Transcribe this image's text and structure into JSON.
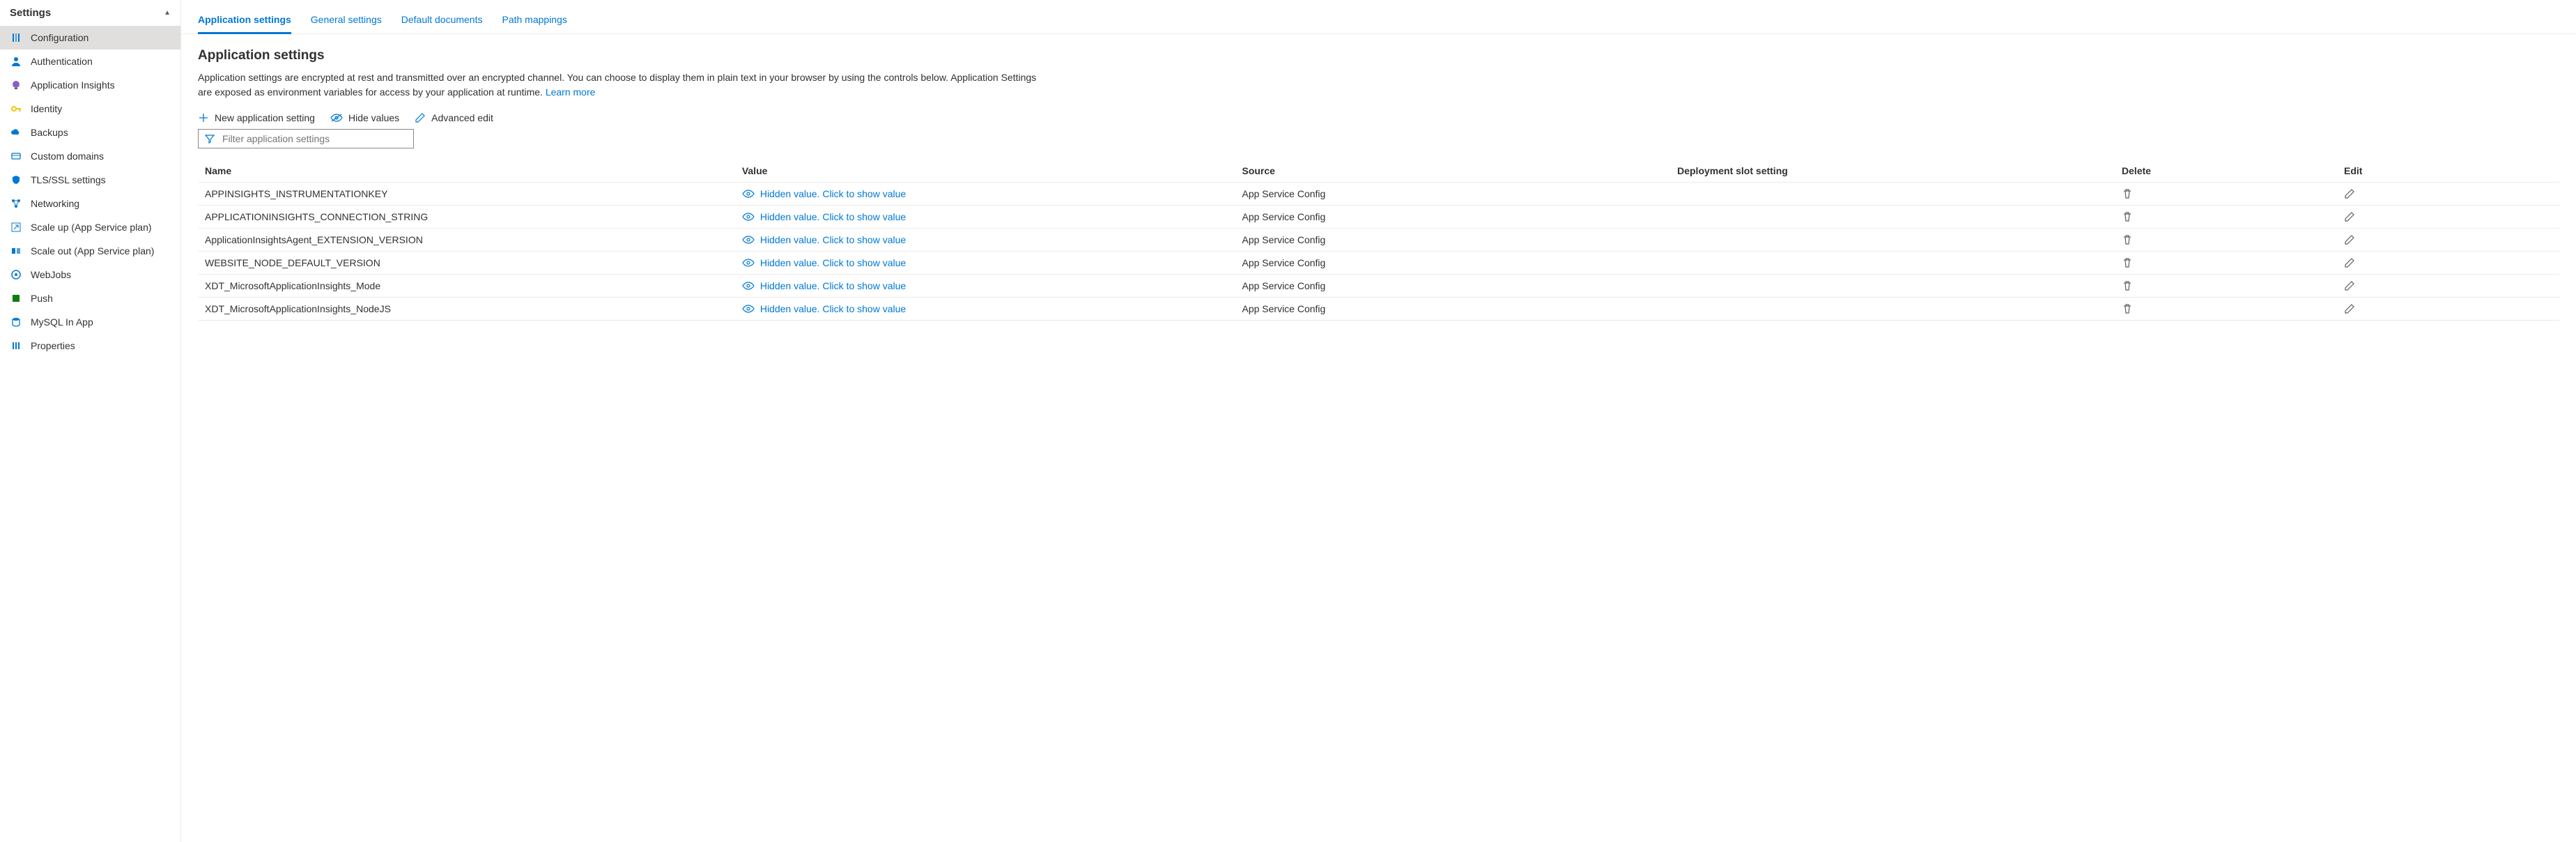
{
  "sidebar": {
    "title": "Settings",
    "items": [
      {
        "label": "Configuration",
        "icon": "sliders",
        "active": true
      },
      {
        "label": "Authentication",
        "icon": "person",
        "active": false
      },
      {
        "label": "Application Insights",
        "icon": "bulb",
        "active": false
      },
      {
        "label": "Identity",
        "icon": "key",
        "active": false
      },
      {
        "label": "Backups",
        "icon": "cloud",
        "active": false
      },
      {
        "label": "Custom domains",
        "icon": "domain",
        "active": false
      },
      {
        "label": "TLS/SSL settings",
        "icon": "shield",
        "active": false
      },
      {
        "label": "Networking",
        "icon": "network",
        "active": false
      },
      {
        "label": "Scale up (App Service plan)",
        "icon": "scaleup",
        "active": false
      },
      {
        "label": "Scale out (App Service plan)",
        "icon": "scaleout",
        "active": false
      },
      {
        "label": "WebJobs",
        "icon": "webjobs",
        "active": false
      },
      {
        "label": "Push",
        "icon": "push",
        "active": false
      },
      {
        "label": "MySQL In App",
        "icon": "mysql",
        "active": false
      },
      {
        "label": "Properties",
        "icon": "properties",
        "active": false
      }
    ]
  },
  "tabs": [
    {
      "label": "Application settings",
      "active": true
    },
    {
      "label": "General settings",
      "active": false
    },
    {
      "label": "Default documents",
      "active": false
    },
    {
      "label": "Path mappings",
      "active": false
    }
  ],
  "section": {
    "title": "Application settings",
    "desc": "Application settings are encrypted at rest and transmitted over an encrypted channel. You can choose to display them in plain text in your browser by using the controls below. Application Settings are exposed as environment variables for access by your application at runtime. ",
    "learn_more": "Learn more"
  },
  "toolbar": {
    "new_setting": "New application setting",
    "hide_values": "Hide values",
    "advanced_edit": "Advanced edit"
  },
  "filter": {
    "placeholder": "Filter application settings"
  },
  "table": {
    "headers": {
      "name": "Name",
      "value": "Value",
      "source": "Source",
      "slot": "Deployment slot setting",
      "delete": "Delete",
      "edit": "Edit"
    },
    "hidden_value_text": "Hidden value. Click to show value",
    "rows": [
      {
        "name": "APPINSIGHTS_INSTRUMENTATIONKEY",
        "source": "App Service Config",
        "slot": ""
      },
      {
        "name": "APPLICATIONINSIGHTS_CONNECTION_STRING",
        "source": "App Service Config",
        "slot": ""
      },
      {
        "name": "ApplicationInsightsAgent_EXTENSION_VERSION",
        "source": "App Service Config",
        "slot": ""
      },
      {
        "name": "WEBSITE_NODE_DEFAULT_VERSION",
        "source": "App Service Config",
        "slot": ""
      },
      {
        "name": "XDT_MicrosoftApplicationInsights_Mode",
        "source": "App Service Config",
        "slot": ""
      },
      {
        "name": "XDT_MicrosoftApplicationInsights_NodeJS",
        "source": "App Service Config",
        "slot": ""
      }
    ]
  }
}
